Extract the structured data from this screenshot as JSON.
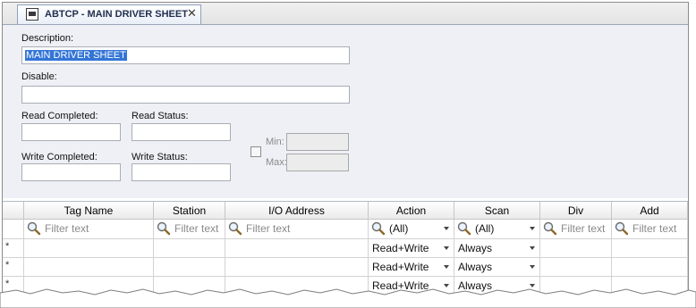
{
  "tab": {
    "title": "ABTCP - MAIN DRIVER SHEET",
    "close_glyph": "✕"
  },
  "form": {
    "description_label": "Description:",
    "description_value": "MAIN DRIVER SHEET",
    "disable_label": "Disable:",
    "disable_value": "",
    "read_completed_label": "Read Completed:",
    "read_completed_value": "",
    "read_status_label": "Read Status:",
    "read_status_value": "",
    "write_completed_label": "Write Completed:",
    "write_completed_value": "",
    "write_status_label": "Write Status:",
    "write_status_value": "",
    "min_label": "Min:",
    "min_value": "",
    "max_label": "Max:",
    "max_value": ""
  },
  "grid": {
    "columns": [
      "Tag Name",
      "Station",
      "I/O Address",
      "Action",
      "Scan",
      "Div",
      "Add"
    ],
    "filter_placeholder": "Filter text",
    "action_filter": "(All)",
    "scan_filter": "(All)",
    "row_marker": "*",
    "rows": [
      {
        "tag_name": "",
        "station": "",
        "io_address": "",
        "action": "Read+Write",
        "scan": "Always",
        "div": "",
        "add": ""
      },
      {
        "tag_name": "",
        "station": "",
        "io_address": "",
        "action": "Read+Write",
        "scan": "Always",
        "div": "",
        "add": ""
      },
      {
        "tag_name": "",
        "station": "",
        "io_address": "",
        "action": "Read+Write",
        "scan": "Always",
        "div": "",
        "add": ""
      }
    ]
  },
  "icons": {
    "tab_icon": "driver-sheet-icon",
    "filter_icon": "magnifier-icon",
    "dropdown_icon": "chevron-down-icon"
  }
}
